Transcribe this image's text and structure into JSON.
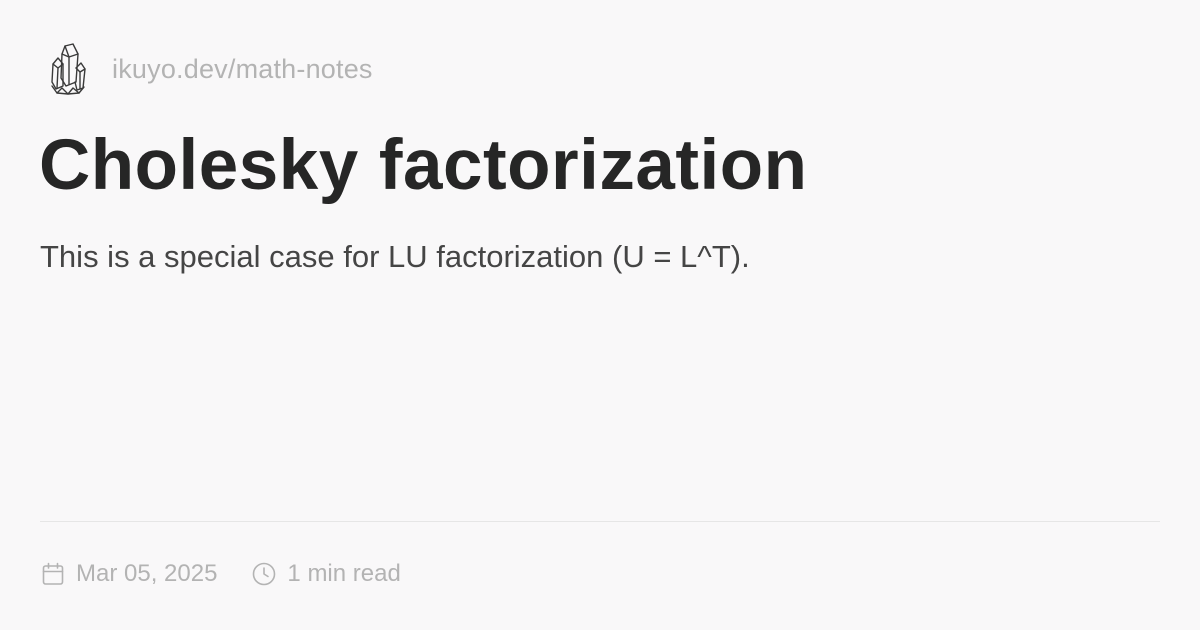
{
  "header": {
    "logo_icon": "crystal-cluster-icon",
    "site_url": "ikuyo.dev/math-notes"
  },
  "article": {
    "title": "Cholesky factorization",
    "description": "This is a special case for LU factorization (U = L^T)."
  },
  "meta": {
    "date": "Mar 05, 2025",
    "date_icon": "calendar-icon",
    "reading_time": "1 min read",
    "reading_time_icon": "clock-icon"
  },
  "colors": {
    "background": "#f9f8f9",
    "title": "#262626",
    "body_text": "#454545",
    "muted_text": "#b3b3b3",
    "divider": "#e6e6e6"
  }
}
